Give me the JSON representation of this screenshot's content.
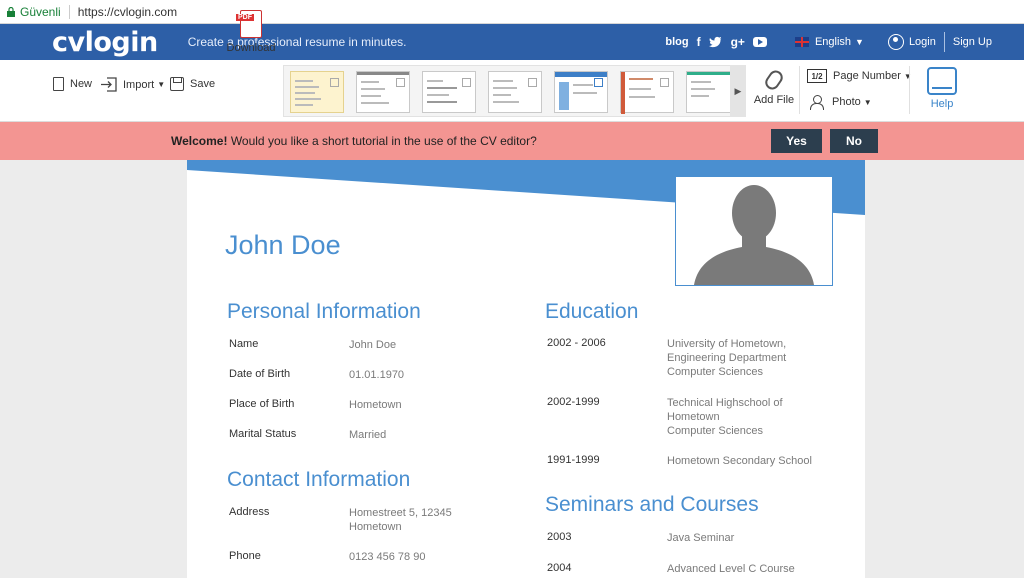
{
  "browser": {
    "secure_label": "Güvenli",
    "url": "https://cvlogin.com"
  },
  "header": {
    "logo": "cvlogin",
    "tagline": "Create a professional resume in minutes.",
    "blog": "blog",
    "language": "English",
    "login": "Login",
    "signup": "Sign Up",
    "brand_color": "#2d5fa7"
  },
  "toolbar": {
    "new_label": "New",
    "import_label": "Import",
    "save_label": "Save",
    "download_label": "Download",
    "add_file_label": "Add File",
    "page_number_label": "Page Number",
    "page_icon_label": "1/2",
    "photo_label": "Photo",
    "help_label": "Help"
  },
  "banner": {
    "welcome": "Welcome!",
    "text": "Would you like a short tutorial in the use of the CV editor?",
    "yes": "Yes",
    "no": "No",
    "bg_color": "#f39592"
  },
  "cv": {
    "name": "John Doe",
    "accent_color": "#4a8fd0",
    "personal": {
      "heading": "Personal Information",
      "rows": [
        {
          "label": "Name",
          "value": "John Doe"
        },
        {
          "label": "Date of Birth",
          "value": "01.01.1970"
        },
        {
          "label": "Place of Birth",
          "value": "Hometown"
        },
        {
          "label": "Marital Status",
          "value": "Married"
        }
      ]
    },
    "contact": {
      "heading": "Contact Information",
      "rows": [
        {
          "label": "Address",
          "value_line1": "Homestreet 5, 12345",
          "value_line2": "Hometown"
        },
        {
          "label": "Phone",
          "value": "0123 456 78 90"
        }
      ]
    },
    "education": {
      "heading": "Education",
      "rows": [
        {
          "label": "2002 - 2006",
          "line1": "University of Hometown,",
          "line2": "Engineering Department",
          "line3": "Computer Sciences"
        },
        {
          "label": "2002-1999",
          "line1": "Technical Highschool of",
          "line2": "Hometown",
          "line3": "Computer Sciences"
        },
        {
          "label": "1991-1999",
          "line1": "Hometown Secondary School"
        }
      ]
    },
    "seminars": {
      "heading": "Seminars and Courses",
      "rows": [
        {
          "label": "2003",
          "value": "Java Seminar"
        },
        {
          "label": "2004",
          "value": "Advanced Level C Course"
        }
      ]
    }
  }
}
